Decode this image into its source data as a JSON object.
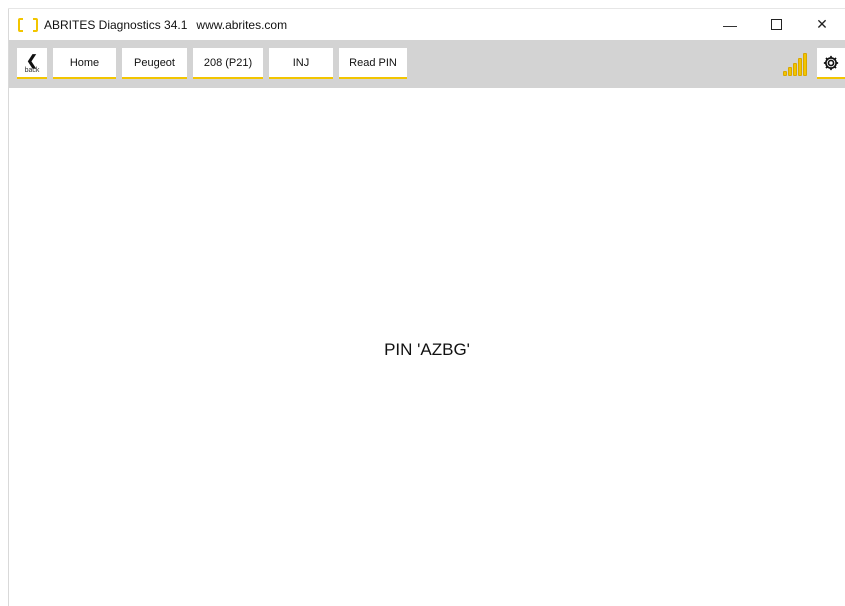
{
  "window": {
    "title": "ABRITES Diagnostics 34.1",
    "url": "www.abrites.com",
    "controls": {
      "minimize": "—",
      "close": "✕"
    }
  },
  "toolbar": {
    "back_label": "back",
    "back_glyph": "❮",
    "breadcrumbs": [
      "Home",
      "Peugeot",
      "208 (P21)",
      "INJ",
      "Read PIN"
    ],
    "signal_level_bars": 5,
    "accent_color": "#f2c500"
  },
  "main": {
    "message": "PIN 'AZBG'"
  }
}
